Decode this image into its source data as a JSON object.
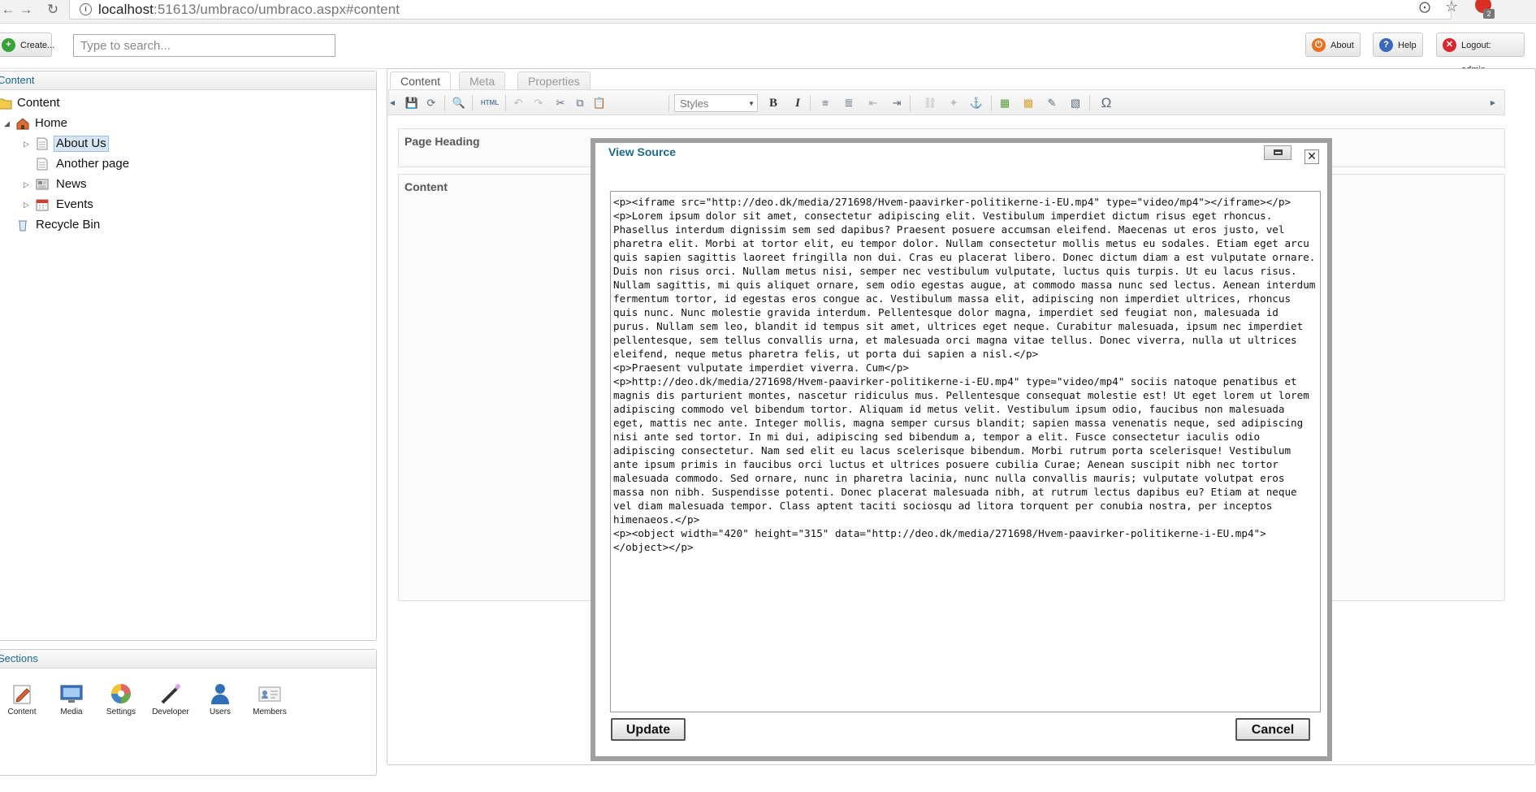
{
  "browser": {
    "url_host": "localhost",
    "url_rest": ":51613/umbraco/umbraco.aspx#content",
    "notification_count": "2"
  },
  "topbar": {
    "create_label": "Create...",
    "search_placeholder": "Type to search...",
    "about_label": "About",
    "help_label": "Help",
    "logout_label": "Logout: admin"
  },
  "tree": {
    "header": "Content",
    "items": [
      {
        "label": "Content",
        "icon": "folder-icon"
      },
      {
        "label": "Home",
        "icon": "house-icon"
      },
      {
        "label": "About Us",
        "icon": "page-icon"
      },
      {
        "label": "Another page",
        "icon": "page-icon"
      },
      {
        "label": "News",
        "icon": "news-icon"
      },
      {
        "label": "Events",
        "icon": "calendar-icon"
      },
      {
        "label": "Recycle Bin",
        "icon": "recycle-bin-icon"
      }
    ]
  },
  "sections": {
    "header": "Sections",
    "items": [
      {
        "label": "Content",
        "icon": "content-pencil-icon"
      },
      {
        "label": "Media",
        "icon": "media-monitor-icon"
      },
      {
        "label": "Settings",
        "icon": "settings-color-wheel-icon"
      },
      {
        "label": "Developer",
        "icon": "developer-wand-icon"
      },
      {
        "label": "Users",
        "icon": "user-icon"
      },
      {
        "label": "Members",
        "icon": "members-card-icon"
      }
    ]
  },
  "editor": {
    "tabs": [
      "Content",
      "Meta",
      "Properties"
    ],
    "styles_label": "Styles",
    "field_page_heading": "Page Heading",
    "field_content": "Content"
  },
  "modal": {
    "title": "View Source",
    "source": "<p><iframe src=\"http://deo.dk/media/271698/Hvem-paavirker-politikerne-i-EU.mp4\" type=\"video/mp4\"></iframe></p>\n<p>Lorem ipsum dolor sit amet, consectetur adipiscing elit. Vestibulum imperdiet dictum risus eget rhoncus. Phasellus interdum dignissim sem sed dapibus? Praesent posuere accumsan eleifend. Maecenas ut eros justo, vel pharetra elit. Morbi at tortor elit, eu tempor dolor. Nullam consectetur mollis metus eu sodales. Etiam eget arcu quis sapien sagittis laoreet fringilla non dui. Cras eu placerat libero. Donec dictum diam a est vulputate ornare. Duis non risus orci. Nullam metus nisi, semper nec vestibulum vulputate, luctus quis turpis. Ut eu lacus risus. Nullam sagittis, mi quis aliquet ornare, sem odio egestas augue, at commodo massa nunc sed lectus. Aenean interdum fermentum tortor, id egestas eros congue ac. Vestibulum massa elit, adipiscing non imperdiet ultrices, rhoncus quis nunc. Nunc molestie gravida interdum. Pellentesque dolor magna, imperdiet sed feugiat non, malesuada id purus. Nullam sem leo, blandit id tempus sit amet, ultrices eget neque. Curabitur malesuada, ipsum nec imperdiet pellentesque, sem tellus convallis urna, et malesuada orci magna vitae tellus. Donec viverra, nulla ut ultrices eleifend, neque metus pharetra felis, ut porta dui sapien a nisl.</p>\n<p>Praesent vulputate imperdiet viverra. Cum</p>\n<p>http://deo.dk/media/271698/Hvem-paavirker-politikerne-i-EU.mp4\" type=\"video/mp4\" sociis natoque penatibus et magnis dis parturient montes, nascetur ridiculus mus. Pellentesque consequat molestie est! Ut eget lorem ut lorem adipiscing commodo vel bibendum tortor. Aliquam id metus velit. Vestibulum ipsum odio, faucibus non malesuada eget, mattis nec ante. Integer mollis, magna semper cursus blandit; sapien massa venenatis neque, sed adipiscing nisi ante sed tortor. In mi dui, adipiscing sed bibendum a, tempor a elit. Fusce consectetur iaculis odio adipiscing consectetur. Nam sed elit eu lacus scelerisque bibendum. Morbi rutrum porta scelerisque! Vestibulum ante ipsum primis in faucibus orci luctus et ultrices posuere cubilia Curae; Aenean suscipit nibh nec tortor malesuada commodo. Sed ornare, nunc in pharetra lacinia, nunc nulla convallis mauris; vulputate volutpat eros massa non nibh. Suspendisse potenti. Donec placerat malesuada nibh, at rutrum lectus dapibus eu? Etiam at neque vel diam malesuada tempor. Class aptent taciti sociosqu ad litora torquent per conubia nostra, per inceptos himenaeos.</p>\n<p><object width=\"420\" height=\"315\" data=\"http://deo.dk/media/271698/Hvem-paavirker-politikerne-i-EU.mp4\"> </object></p>",
    "update_label": "Update",
    "cancel_label": "Cancel"
  },
  "colors": {
    "accent_text": "#1c6a8a",
    "modal_border": "#a0a0a0",
    "selected_bg": "#d6e6f7"
  }
}
